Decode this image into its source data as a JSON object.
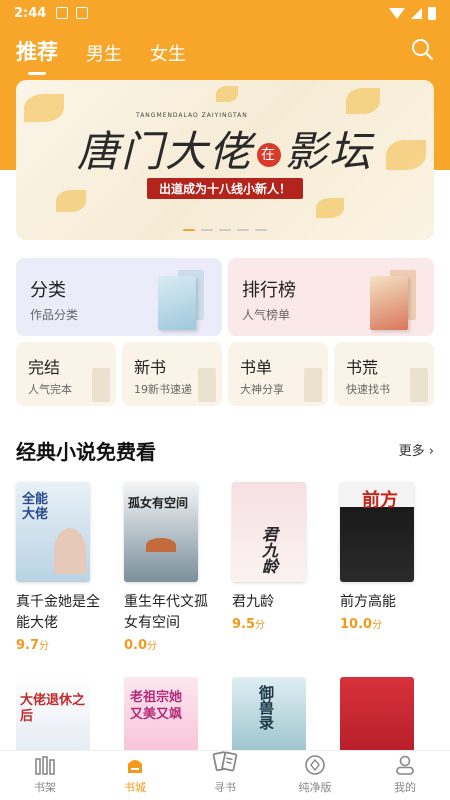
{
  "status_bar": {
    "time": "2:44"
  },
  "tabs": [
    {
      "label": "推荐",
      "active": true
    },
    {
      "label": "男生",
      "active": false
    },
    {
      "label": "女生",
      "active": false
    }
  ],
  "banner": {
    "title_part1": "唐门大佬",
    "title_mark": "在",
    "title_part2": "影坛",
    "subtitle": "出道成为十八线小新人！",
    "tiny_text": "TANGMENDALAO ZAIYINGTAN",
    "page_count": 5,
    "active_page": 0
  },
  "categories": {
    "big": [
      {
        "title": "分类",
        "subtitle": "作品分类"
      },
      {
        "title": "排行榜",
        "subtitle": "人气榜单"
      }
    ],
    "small": [
      {
        "title": "完结",
        "subtitle": "人气完本"
      },
      {
        "title": "新书",
        "subtitle": "19新书速递"
      },
      {
        "title": "书单",
        "subtitle": "大神分享"
      },
      {
        "title": "书荒",
        "subtitle": "快速找书"
      }
    ]
  },
  "section": {
    "title": "经典小说免费看",
    "more_label": "更多",
    "books": [
      {
        "name": "真千金她是全能大佬",
        "score": "9.7",
        "unit": "分",
        "cover_text": "全能大佬"
      },
      {
        "name": "重生年代文孤女有空间",
        "score": "0.0",
        "unit": "分",
        "cover_text": "孤女有空间"
      },
      {
        "name": "君九龄",
        "score": "9.5",
        "unit": "分",
        "cover_text": "君九龄"
      },
      {
        "name": "前方高能",
        "score": "10.0",
        "unit": "分",
        "cover_text": "前方"
      }
    ],
    "next_covers": [
      "大佬退休之后",
      "老祖宗她又美又飒",
      "御兽录",
      ""
    ]
  },
  "bottom_nav": [
    {
      "label": "书架",
      "icon": "bookshelf-icon",
      "active": false
    },
    {
      "label": "书城",
      "icon": "bookstore-icon",
      "active": true
    },
    {
      "label": "寻书",
      "icon": "find-book-icon",
      "active": false
    },
    {
      "label": "纯净版",
      "icon": "pure-version-icon",
      "active": false
    },
    {
      "label": "我的",
      "icon": "profile-icon",
      "active": false
    }
  ],
  "colors": {
    "accent": "#f8a62a",
    "score": "#f39a1c",
    "banner_red": "#b3241c"
  }
}
